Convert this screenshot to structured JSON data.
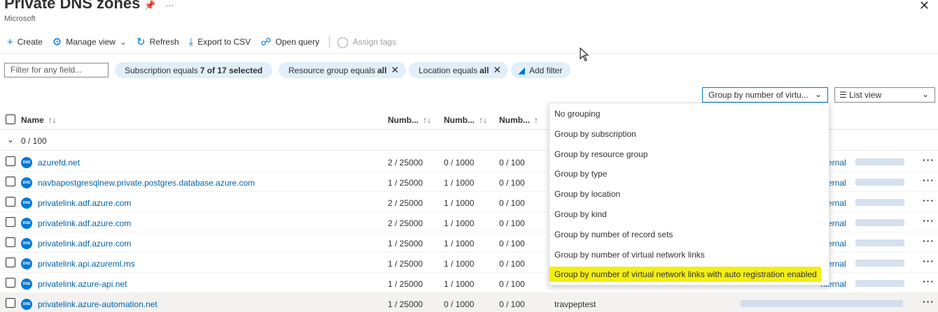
{
  "header": {
    "title": "Private DNS zones",
    "subtitle": "Microsoft",
    "pin_icon": "pin-icon",
    "more_label": "···",
    "close_label": "✕"
  },
  "toolbar": {
    "create": "Create",
    "manage_view": "Manage view",
    "refresh": "Refresh",
    "export_csv": "Export to CSV",
    "open_query": "Open query",
    "assign_tags": "Assign tags"
  },
  "filters": {
    "placeholder": "Filter for any field...",
    "subscription_prefix": "Subscription equals",
    "subscription_value": "7 of 17 selected",
    "resource_group_prefix": "Resource group equals",
    "resource_group_value": "all",
    "location_prefix": "Location equals",
    "location_value": "all",
    "add_filter": "Add filter"
  },
  "grouping": {
    "selected": "Group by number of virtu...",
    "view": "List view",
    "options": [
      "No grouping",
      "Group by subscription",
      "Group by resource group",
      "Group by type",
      "Group by location",
      "Group by kind",
      "Group by number of record sets",
      "Group by number of virtual network links",
      "Group by number of virtual network links with auto registration enabled"
    ]
  },
  "grid": {
    "columns": {
      "name": "Name",
      "num1": "Numb...",
      "num2": "Numb...",
      "num3": "Numb..."
    },
    "group_label": "0 / 100",
    "rows": [
      {
        "name": "azurefd.net",
        "c1": "2 / 25000",
        "c2": "0 / 1000",
        "c3": "0 / 100",
        "rg": "",
        "sub": "nternal"
      },
      {
        "name": "navbapostgresqlnew.private.postgres.database.azure.com",
        "c1": "1 / 25000",
        "c2": "1 / 1000",
        "c3": "0 / 100",
        "rg": "",
        "sub": "nternal"
      },
      {
        "name": "privatelink.adf.azure.com",
        "c1": "2 / 25000",
        "c2": "1 / 1000",
        "c3": "0 / 100",
        "rg": "",
        "sub": "nternal"
      },
      {
        "name": "privatelink.adf.azure.com",
        "c1": "2 / 25000",
        "c2": "1 / 1000",
        "c3": "0 / 100",
        "rg": "",
        "sub": "nternal"
      },
      {
        "name": "privatelink.adf.azure.com",
        "c1": "1 / 25000",
        "c2": "1 / 1000",
        "c3": "0 / 100",
        "rg": "",
        "sub": "nternal"
      },
      {
        "name": "privatelink.api.azureml.ms",
        "c1": "1 / 25000",
        "c2": "1 / 1000",
        "c3": "0 / 100",
        "rg": "",
        "sub": "nternal"
      },
      {
        "name": "privatelink.azure-api.net",
        "c1": "1 / 25000",
        "c2": "1 / 1000",
        "c3": "0 / 100",
        "rg": "",
        "sub": "nternal"
      },
      {
        "name": "privatelink.azure-automation.net",
        "c1": "1 / 25000",
        "c2": "0 / 1000",
        "c3": "0 / 100",
        "rg": "travpeptest",
        "sub": ""
      }
    ]
  },
  "colors": {
    "accent": "#0078d4",
    "link": "#0062ad",
    "pill_bg": "#e1effa",
    "highlight": "#f4ee12"
  }
}
